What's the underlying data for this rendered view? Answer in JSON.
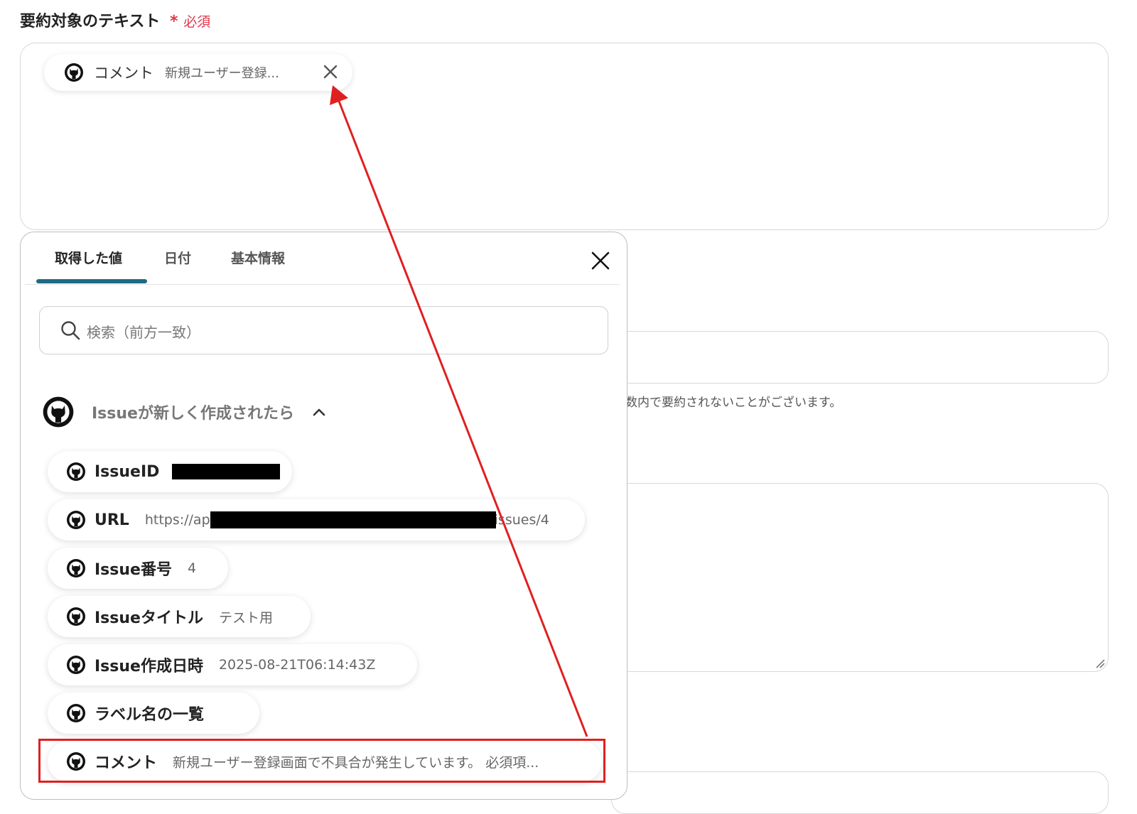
{
  "field": {
    "label": "要約対象のテキスト",
    "required_star": "*",
    "required_text": "必須"
  },
  "selected_chip": {
    "label": "コメント",
    "value": "新規ユーザー登録..."
  },
  "background": {
    "help_text": "数内で要約されないことがございます。"
  },
  "panel": {
    "tabs": [
      {
        "label": "取得した値",
        "active": true
      },
      {
        "label": "日付",
        "active": false
      },
      {
        "label": "基本情報",
        "active": false
      }
    ],
    "search": {
      "placeholder": "検索（前方一致）"
    },
    "group": {
      "title": "Issueが新しく作成されたら"
    },
    "items": [
      {
        "label": "IssueID",
        "value": ""
      },
      {
        "label": "URL",
        "value": "https://ap",
        "value_tail": "issues/4"
      },
      {
        "label": "Issue番号",
        "value": "4"
      },
      {
        "label": "Issueタイトル",
        "value": "テスト用"
      },
      {
        "label": "Issue作成日時",
        "value": "2025-08-21T06:14:43Z"
      },
      {
        "label": "ラベル名の一覧",
        "value": ""
      },
      {
        "label": "コメント",
        "value": "新規ユーザー登録画面で不具合が発生しています。 必須項..."
      }
    ]
  },
  "colors": {
    "required": "#e0364b",
    "tab_underline": "#1f6a84",
    "annotation": "#e02020"
  },
  "icons": [
    "github-icon",
    "close-icon",
    "search-icon",
    "chevron-up-icon"
  ]
}
